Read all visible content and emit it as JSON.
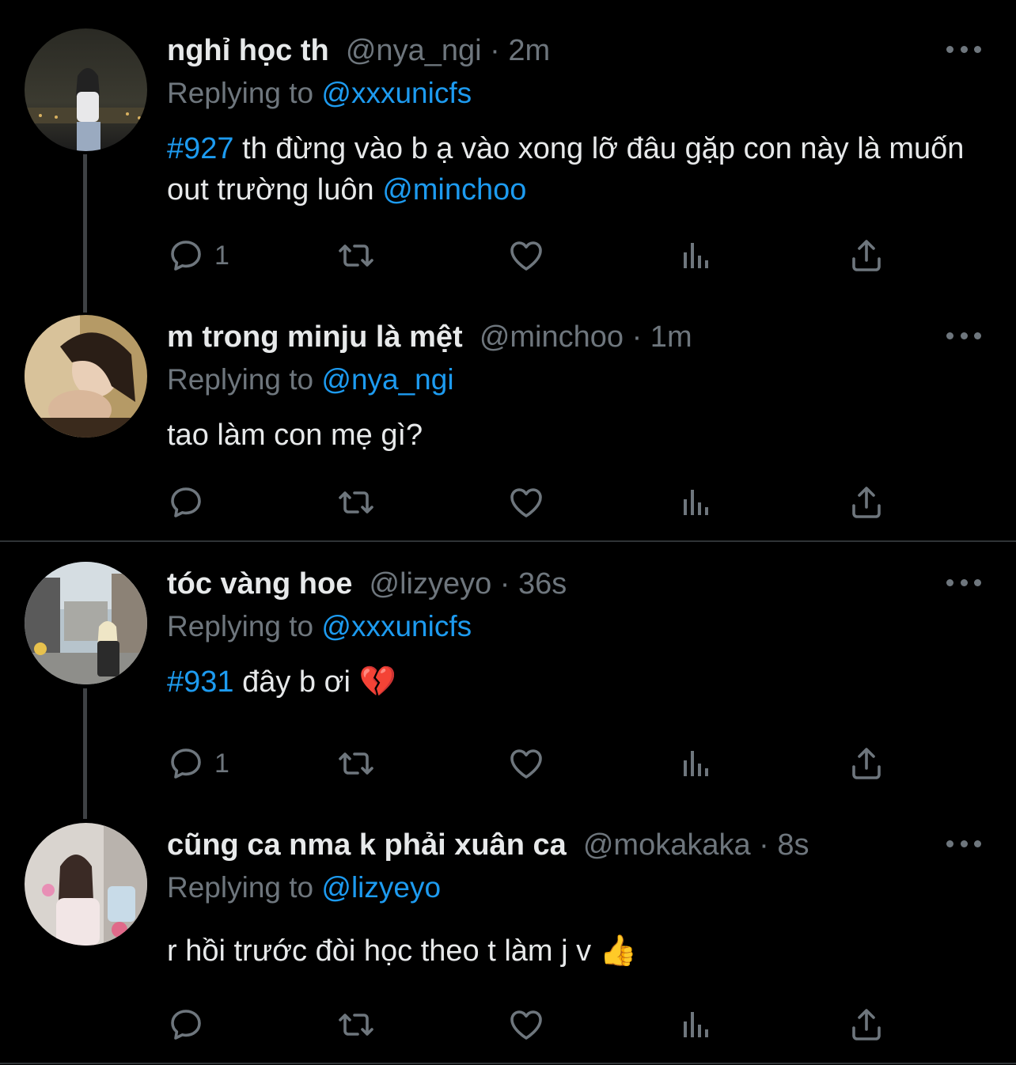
{
  "colors": {
    "background": "#000000",
    "link": "#1d9bf0",
    "muted": "#6e767d",
    "text": "#e7e9ea"
  },
  "icons": [
    "reply-icon",
    "retweet-icon",
    "like-icon",
    "analytics-icon",
    "share-icon",
    "more-icon"
  ],
  "tweets": [
    {
      "name": "nghỉ học th",
      "meta": "@nya_ngi · 2m",
      "replying_prefix": "Replying to",
      "replying_handle": "@xxxunicfs",
      "hashtag": "#927",
      "text": " th đừng vào b ạ vào xong lỡ đâu gặp con này là muốn out trường luôn ",
      "mention": "@minchoo",
      "reply_count": "1"
    },
    {
      "name": "m trong minju là mệt",
      "meta": "@minchoo · 1m",
      "replying_prefix": "Replying to",
      "replying_handle": "@nya_ngi",
      "text": "tao làm con mẹ gì?",
      "reply_count": ""
    },
    {
      "name": "tóc vàng hoe",
      "meta": "@lizyeyo · 36s",
      "replying_prefix": "Replying to",
      "replying_handle": "@xxxunicfs",
      "hashtag": "#931",
      "text": " đây b ơi 💔",
      "reply_count": "1"
    },
    {
      "name": "cũng ca nma k phải xuân ca",
      "meta": "@mokakaka · 8s",
      "replying_prefix": "Replying to",
      "replying_handle": "@lizyeyo",
      "text": "r hồi trước đòi học theo t làm j v 👍",
      "reply_count": ""
    }
  ]
}
